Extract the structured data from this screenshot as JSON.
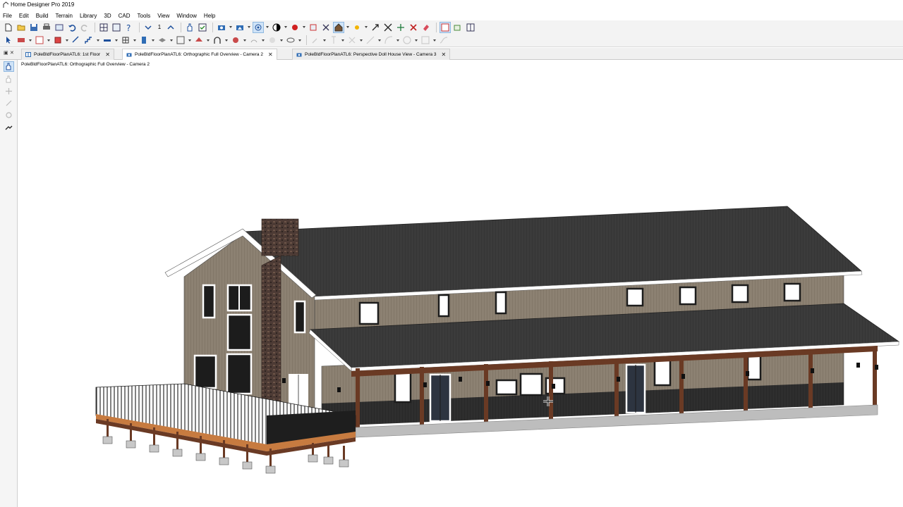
{
  "window": {
    "title": "Home Designer Pro 2019"
  },
  "menu": [
    "File",
    "Edit",
    "Build",
    "Terrain",
    "Library",
    "3D",
    "CAD",
    "Tools",
    "View",
    "Window",
    "Help"
  ],
  "toolbar": {
    "floor_number": "1"
  },
  "tabs": [
    {
      "label": "PoleBldFloorPlanATL6: 1st Floor",
      "icon": "floor-plan-icon",
      "active": false
    },
    {
      "label": "PoleBldFloorPlanATL6: Orthographic Full Overview - Camera 2",
      "icon": "camera-icon",
      "active": true
    },
    {
      "label": "PoleBldFloorPlanATL6: Perspective Doll House View - Camera 3",
      "icon": "camera-icon",
      "active": false
    }
  ],
  "viewport": {
    "title": "PoleBldFloorPlanATL6: Orthographic Full Overview - Camera 2"
  },
  "colors": {
    "roof": "#3b3b3b",
    "siding": "#8c8172",
    "trim": "#ffffff",
    "posts": "#6a3a24",
    "deck": "#2a2a2a",
    "chimney": "#5b3a30",
    "accent": "#cfe3f7"
  }
}
